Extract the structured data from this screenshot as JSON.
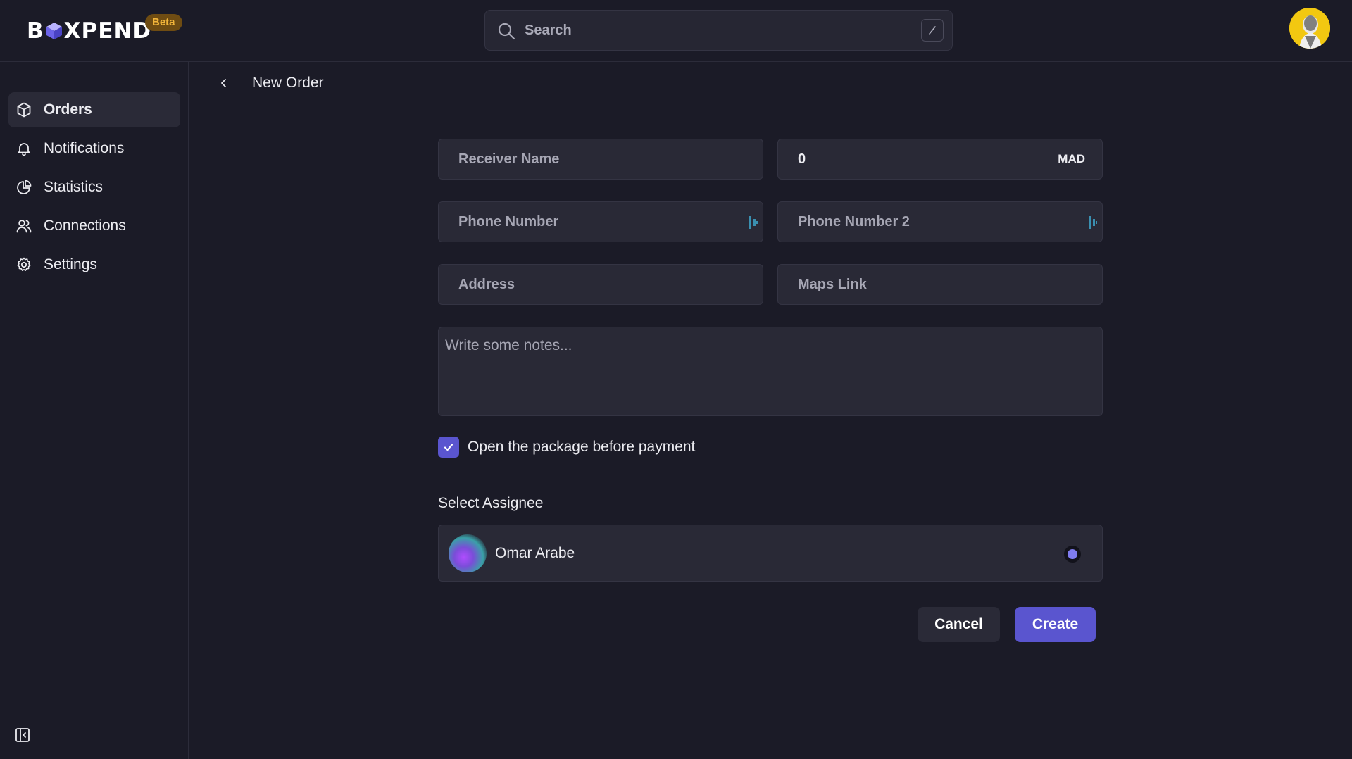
{
  "app": {
    "logo_text_left": "B",
    "logo_text_right": "XPEND",
    "beta_label": "Beta"
  },
  "search": {
    "placeholder": "Search"
  },
  "sidebar": {
    "items": [
      {
        "label": "Orders",
        "icon": "box-icon",
        "active": true
      },
      {
        "label": "Notifications",
        "icon": "bell-icon",
        "active": false
      },
      {
        "label": "Statistics",
        "icon": "pie-chart-icon",
        "active": false
      },
      {
        "label": "Connections",
        "icon": "users-icon",
        "active": false
      },
      {
        "label": "Settings",
        "icon": "gear-icon",
        "active": false
      }
    ]
  },
  "page": {
    "title": "New Order"
  },
  "form": {
    "receiver_name_placeholder": "Receiver Name",
    "amount_value": "0",
    "currency": "MAD",
    "phone_placeholder": "Phone Number",
    "phone2_placeholder": "Phone Number 2",
    "address_placeholder": "Address",
    "maps_link_placeholder": "Maps Link",
    "notes_placeholder": "Write some notes...",
    "open_package_label": "Open the package before payment",
    "open_package_checked": true,
    "assignee_section_title": "Select Assignee",
    "assignees": [
      {
        "name": "Omar Arabe",
        "selected": true
      }
    ],
    "cancel_label": "Cancel",
    "create_label": "Create"
  },
  "colors": {
    "background": "#1b1b27",
    "field_bg": "#292936",
    "accent": "#5a55cf",
    "beta_bg": "#6f4c12",
    "beta_text": "#f2b53a"
  }
}
